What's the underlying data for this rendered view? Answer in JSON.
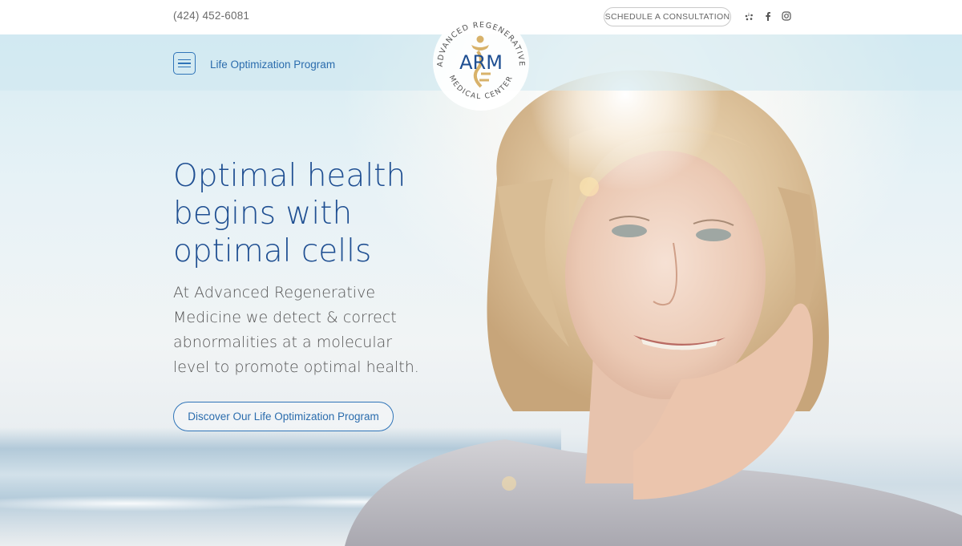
{
  "header": {
    "phone": "(424) 452-6081",
    "consult_label": "SCHEDULE A CONSULTATION",
    "socials": [
      "yelp-icon",
      "facebook-icon",
      "instagram-icon"
    ]
  },
  "nav": {
    "menu_icon": "hamburger-icon",
    "program_link": "Life Optimization Program"
  },
  "logo": {
    "text_top": "ADVANCED REGENERATIVE",
    "text_bottom": "MEDICAL CENTER",
    "monogram": "ARM"
  },
  "hero": {
    "headline_lines": [
      "Optimal health",
      "begins with",
      "optimal cells"
    ],
    "subtext_lines": [
      "At Advanced Regenerative",
      "Medicine we detect & correct",
      "abnormalities at a molecular",
      "level to promote optimal health."
    ],
    "cta_label": "Discover Our Life Optimization Program"
  },
  "colors": {
    "brand_blue": "#1f4f92",
    "accent_blue": "#2f74b8",
    "gold": "#d8b26a"
  }
}
